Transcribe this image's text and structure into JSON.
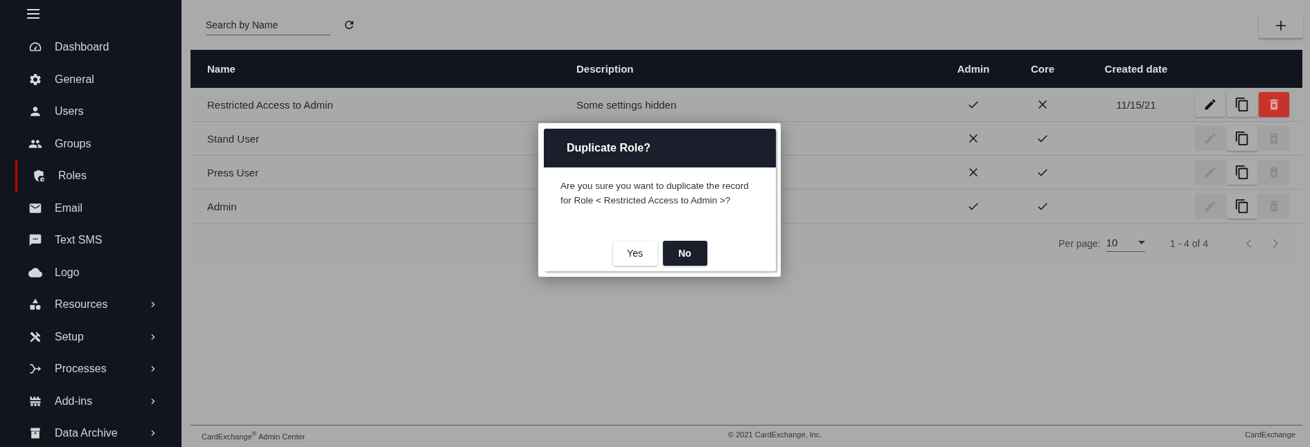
{
  "sidebar": {
    "items": [
      {
        "label": "Dashboard",
        "selected": false,
        "expandable": false
      },
      {
        "label": "General",
        "selected": false,
        "expandable": false
      },
      {
        "label": "Users",
        "selected": false,
        "expandable": false
      },
      {
        "label": "Groups",
        "selected": false,
        "expandable": false
      },
      {
        "label": "Roles",
        "selected": true,
        "expandable": false
      },
      {
        "label": "Email",
        "selected": false,
        "expandable": false
      },
      {
        "label": "Text SMS",
        "selected": false,
        "expandable": false
      },
      {
        "label": "Logo",
        "selected": false,
        "expandable": false
      },
      {
        "label": "Resources",
        "selected": false,
        "expandable": true
      },
      {
        "label": "Setup",
        "selected": false,
        "expandable": true
      },
      {
        "label": "Processes",
        "selected": false,
        "expandable": true
      },
      {
        "label": "Add-ins",
        "selected": false,
        "expandable": true
      },
      {
        "label": "Data Archive",
        "selected": false,
        "expandable": true
      }
    ]
  },
  "search": {
    "placeholder": "Search by Name"
  },
  "table": {
    "columns": [
      "Name",
      "Description",
      "Admin",
      "Core",
      "Created date"
    ],
    "rows": [
      {
        "name": "Restricted Access to Admin",
        "description": "Some settings hidden",
        "admin": true,
        "core": false,
        "created": "11/15/21",
        "editable": true,
        "deletable": true
      },
      {
        "name": "Stand User",
        "admin": false,
        "core": true,
        "editable": false,
        "deletable": false
      },
      {
        "name": "Press User",
        "admin": false,
        "core": true,
        "editable": false,
        "deletable": false
      },
      {
        "name": "Admin",
        "admin": true,
        "core": true,
        "editable": false,
        "deletable": false
      }
    ]
  },
  "pagination": {
    "per_page_label": "Per page:",
    "per_page": "10",
    "range": "1 - 4 of 4"
  },
  "dialog": {
    "title": "Duplicate Role?",
    "message": "Are you sure you want to duplicate the record for Role < Restricted Access to Admin >?",
    "buttons": [
      {
        "label": "Yes",
        "primary": false
      },
      {
        "label": "No",
        "primary": true
      }
    ]
  },
  "footer": {
    "left": "CardExchange$^{®}$ Admin Center",
    "center": "© 2021 CardExchange, Inc.",
    "right": "CardExchange"
  }
}
